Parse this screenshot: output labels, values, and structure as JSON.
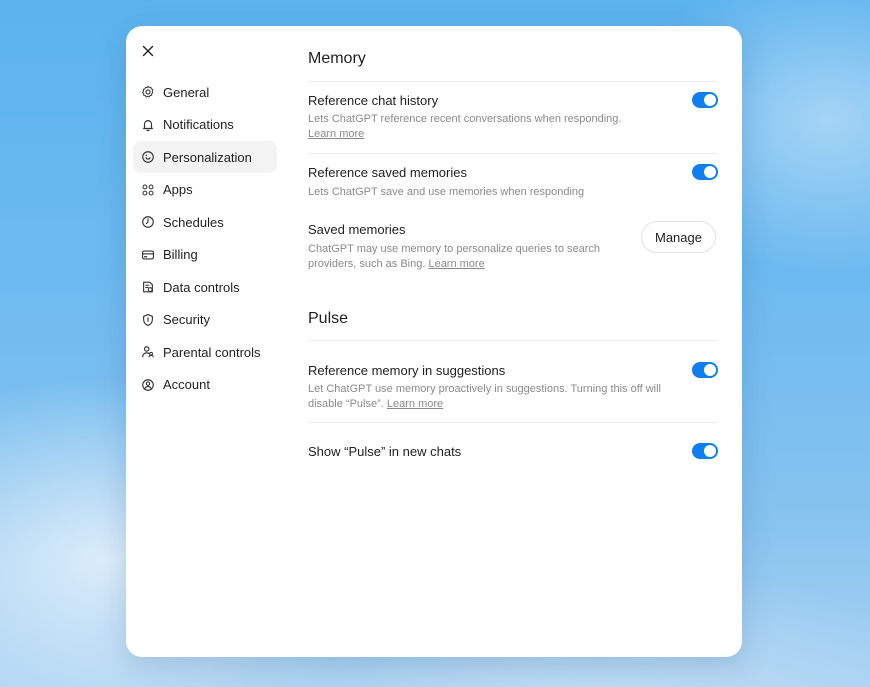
{
  "sidebar": {
    "items": [
      {
        "label": "General",
        "icon": "gear-icon"
      },
      {
        "label": "Notifications",
        "icon": "bell-icon"
      },
      {
        "label": "Personalization",
        "icon": "personalization-icon",
        "active": true
      },
      {
        "label": "Apps",
        "icon": "apps-grid-icon"
      },
      {
        "label": "Schedules",
        "icon": "clock-icon"
      },
      {
        "label": "Billing",
        "icon": "credit-card-icon"
      },
      {
        "label": "Data controls",
        "icon": "database-icon"
      },
      {
        "label": "Security",
        "icon": "shield-icon"
      },
      {
        "label": "Parental controls",
        "icon": "parent-icon"
      },
      {
        "label": "Account",
        "icon": "account-icon"
      }
    ]
  },
  "memory": {
    "title": "Memory",
    "reference_chat_history": {
      "title": "Reference chat history",
      "desc": "Lets ChatGPT reference recent conversations when responding.",
      "link": "Learn more",
      "enabled": true
    },
    "reference_saved_memories": {
      "title": "Reference saved memories",
      "desc": "Lets ChatGPT save and use memories when responding",
      "enabled": true
    },
    "saved_memories": {
      "title": "Saved memories",
      "desc": "ChatGPT may use memory to personalize queries to search providers, such as Bing.",
      "link": "Learn more",
      "button": "Manage"
    }
  },
  "pulse": {
    "title": "Pulse",
    "reference_memory_suggestions": {
      "title": "Reference memory in suggestions",
      "desc": "Let ChatGPT use memory proactively in suggestions. Turning this off will disable “Pulse”.",
      "link": "Learn more",
      "enabled": true
    },
    "show_pulse": {
      "title": "Show “Pulse” in new chats",
      "enabled": true
    }
  },
  "colors": {
    "toggle_on": "#0f7ff0",
    "active_nav_bg": "#f3f3f3"
  }
}
